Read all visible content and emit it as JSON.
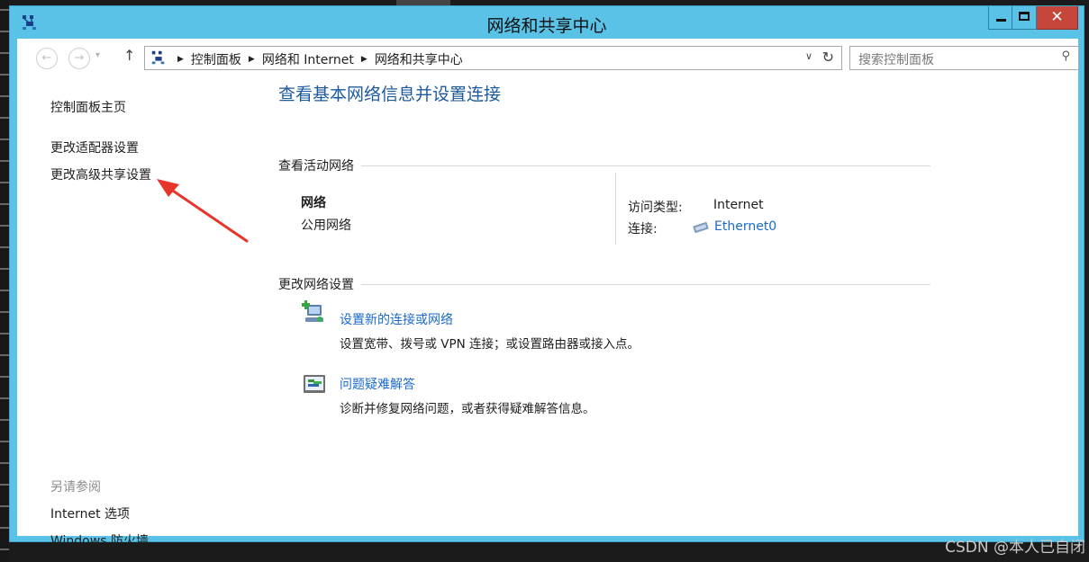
{
  "window": {
    "title": "网络和共享中心",
    "close_symbol": "✕"
  },
  "nav": {
    "back_symbol": "←",
    "forward_symbol": "→",
    "dropdown_symbol": "▾",
    "up_symbol": "↑"
  },
  "address": {
    "crumbs": [
      "控制面板",
      "网络和 Internet",
      "网络和共享中心"
    ],
    "separator": "▶",
    "dropdown_symbol": "∨",
    "refresh_symbol": "↻"
  },
  "search": {
    "placeholder": "搜索控制面板",
    "icon_symbol": "⚲"
  },
  "sidebar": {
    "home": "控制面板主页",
    "adapter_settings": "更改适配器设置",
    "advanced_sharing": "更改高级共享设置",
    "see_also_title": "另请参阅",
    "see_also": [
      "Internet 选项",
      "Windows 防火墙"
    ]
  },
  "main": {
    "title": "查看基本网络信息并设置连接",
    "active_networks_header": "查看活动网络",
    "network": {
      "name": "网络",
      "category": "公用网络",
      "access_type_label": "访问类型:",
      "access_type_value": "Internet",
      "connections_label": "连接:",
      "connection_name": "Ethernet0"
    },
    "change_settings_header": "更改网络设置",
    "tasks": [
      {
        "label": "设置新的连接或网络",
        "description": "设置宽带、拨号或 VPN 连接；或设置路由器或接入点。"
      },
      {
        "label": "问题疑难解答",
        "description": "诊断并修复网络问题，或者获得疑难解答信息。"
      }
    ]
  },
  "annotation": {
    "arrow_color": "#e8352b"
  },
  "watermark": "CSDN @本人已自闭",
  "colors": {
    "title_bar": "#5bc2e7",
    "link": "#1b6ac9",
    "page_title": "#1c5a9e",
    "close_button": "#c7463a"
  }
}
